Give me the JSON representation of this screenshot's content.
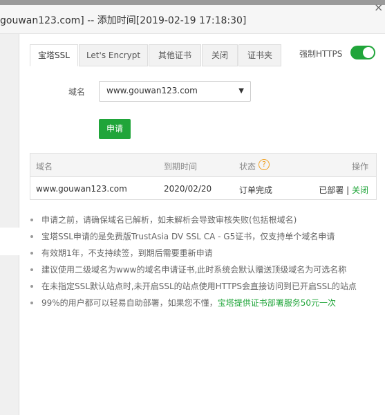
{
  "window": {
    "title": "gouwan123.com] -- 添加时间[2019-02-19 17:18:30]",
    "close_glyph": "×"
  },
  "tabs": [
    {
      "label": "宝塔SSL",
      "active": true
    },
    {
      "label": "Let's Encrypt",
      "active": false
    },
    {
      "label": "其他证书",
      "active": false
    },
    {
      "label": "关闭",
      "active": false
    },
    {
      "label": "证书夹",
      "active": false
    }
  ],
  "force_https": {
    "label": "强制HTTPS",
    "enabled": true,
    "color": "#20a53a"
  },
  "form": {
    "domain_label": "域名",
    "domain_value": "www.gouwan123.com",
    "dropdown_arrow": "▼",
    "apply_label": "申请"
  },
  "table": {
    "headers": {
      "domain": "域名",
      "expiry": "到期时间",
      "status": "状态",
      "help": "?",
      "actions": "操作"
    },
    "rows": [
      {
        "domain": "www.gouwan123.com",
        "expiry": "2020/02/20",
        "status": "订单完成",
        "deployed": "已部署",
        "separator": " | ",
        "close": "关闭"
      }
    ]
  },
  "notes": [
    {
      "text": "申请之前，请确保域名已解析，如未解析会导致审核失败(包括根域名)"
    },
    {
      "text": "宝塔SSL申请的是免费版TrustAsia DV SSL CA - G5证书，仅支持单个域名申请"
    },
    {
      "text": "有效期1年，不支持续签，到期后需要重新申请"
    },
    {
      "text": "建议使用二级域名为www的域名申请证书,此时系统会默认赠送顶级域名为可选名称"
    },
    {
      "text": "在未指定SSL默认站点时,未开启SSL的站点使用HTTPS会直接访问到已开启SSL的站点"
    },
    {
      "text": "99%的用户都可以轻易自助部署，如果您不懂，",
      "link": "宝塔提供证书部署服务50元一次"
    }
  ],
  "colors": {
    "accent": "#20a53a",
    "warning": "#f0a020"
  }
}
